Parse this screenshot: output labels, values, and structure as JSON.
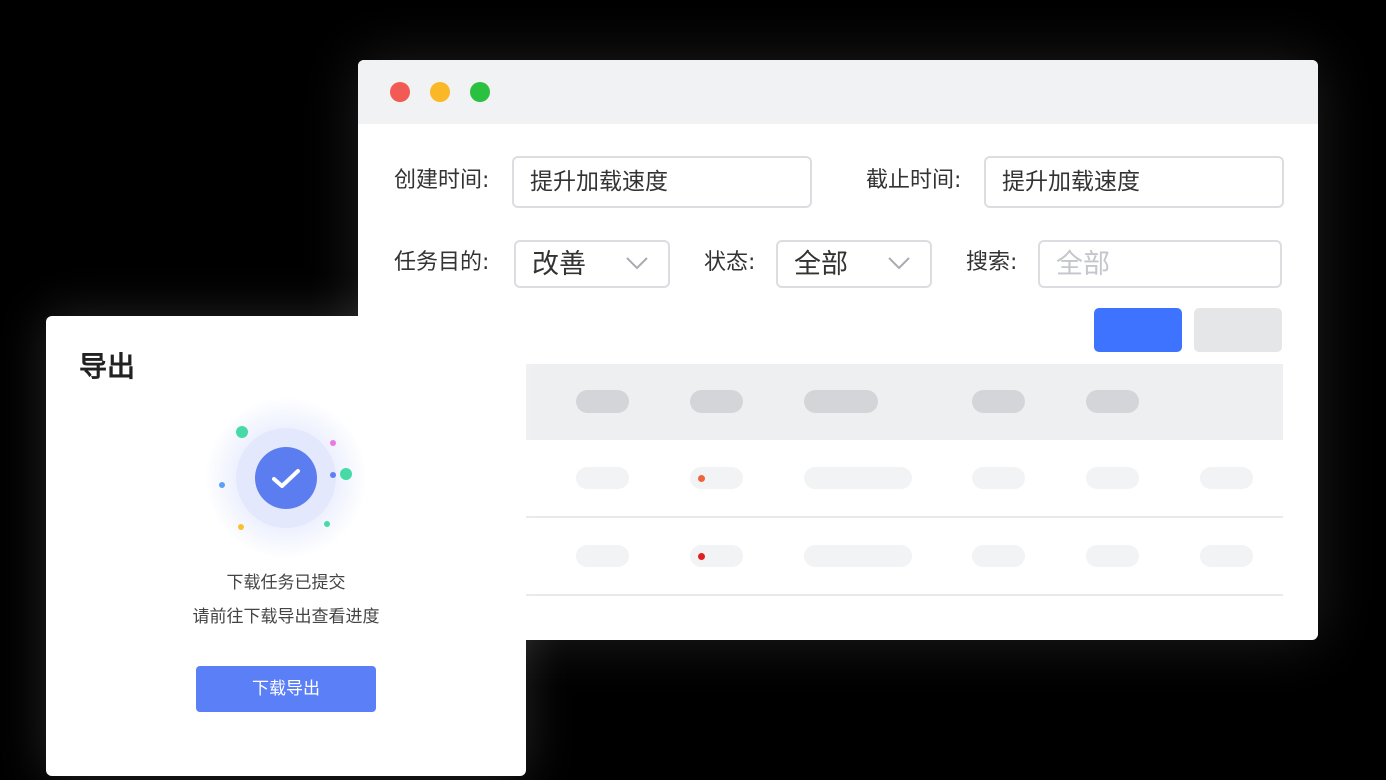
{
  "window": {
    "controls": [
      "close",
      "minimize",
      "maximize"
    ]
  },
  "filters": {
    "created_label": "创建时间:",
    "created_value": "提升加载速度",
    "deadline_label": "截止时间:",
    "deadline_value": "提升加载速度",
    "purpose_label": "任务目的:",
    "purpose_value": "改善",
    "status_label": "状态:",
    "status_value": "全部",
    "search_label": "搜索:",
    "search_placeholder": "全部"
  },
  "table": {
    "status_dot_colors": [
      "#f0643c",
      "#e02020"
    ]
  },
  "dialog": {
    "title": "导出",
    "message_line1": "下载任务已提交",
    "message_line2": "请前往下载导出查看进度",
    "button_label": "下载导出",
    "success_icon": "check-circle-icon",
    "accent_color": "#5b7ff7"
  }
}
